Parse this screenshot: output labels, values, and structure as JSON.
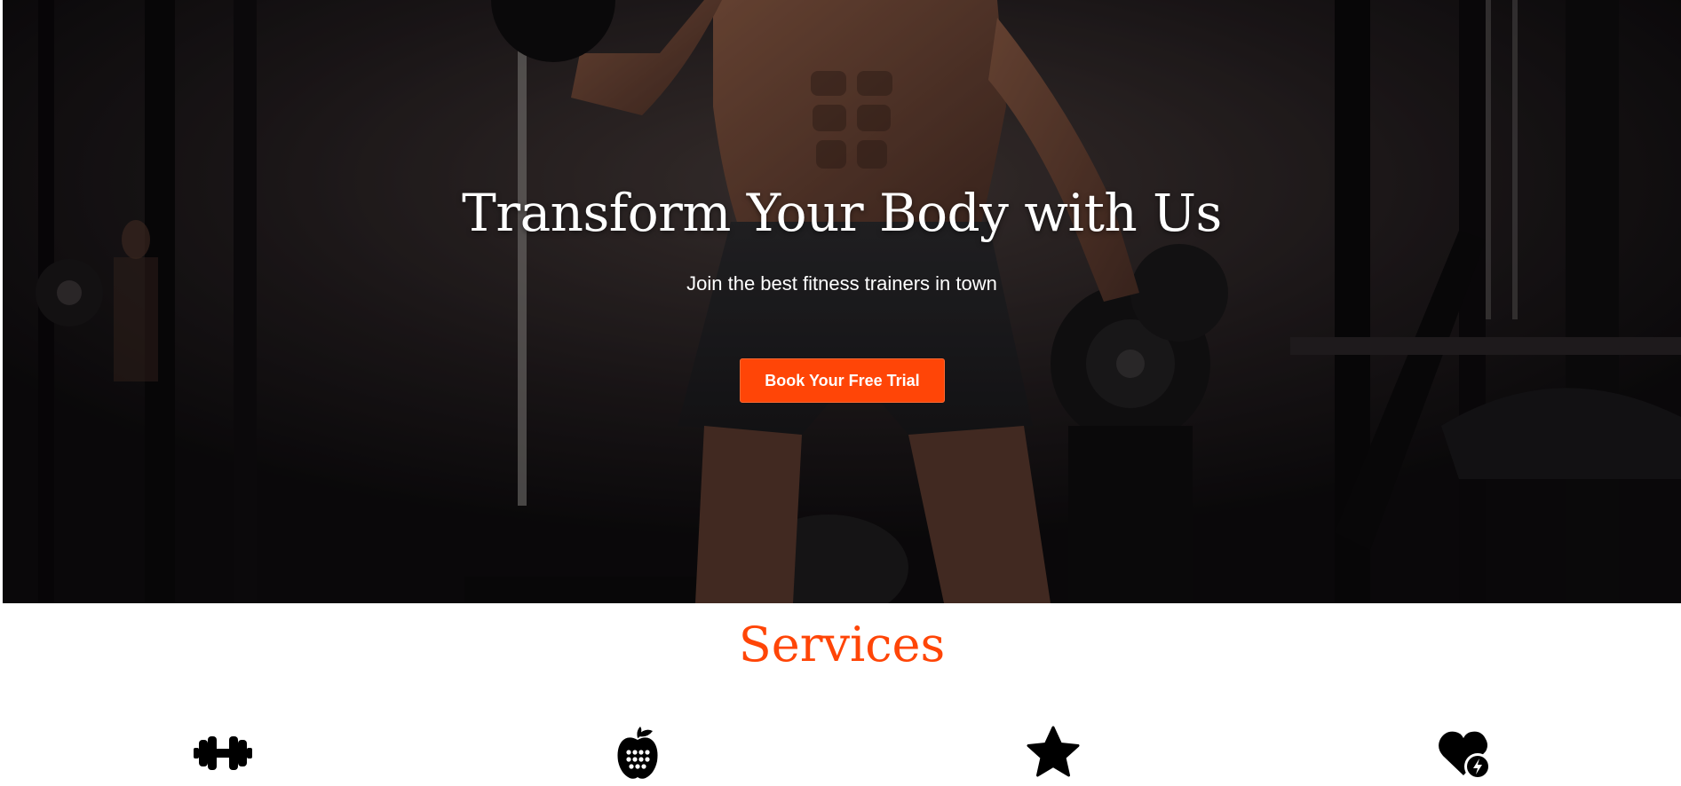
{
  "hero": {
    "title": "Transform Your Body with Us",
    "subtitle": "Join the best fitness trainers in town",
    "cta_label": "Book Your Free Trial",
    "background": "gym-photo-muscular-man-lifting-dumbbells"
  },
  "services": {
    "title": "Services",
    "icons": [
      "dumbbell-icon",
      "nutrition-apple-icon",
      "star-icon",
      "heart-bolt-icon"
    ]
  },
  "colors": {
    "accent": "#ff4507",
    "hero_text": "#ffffff",
    "page_background": "#ffffff"
  }
}
